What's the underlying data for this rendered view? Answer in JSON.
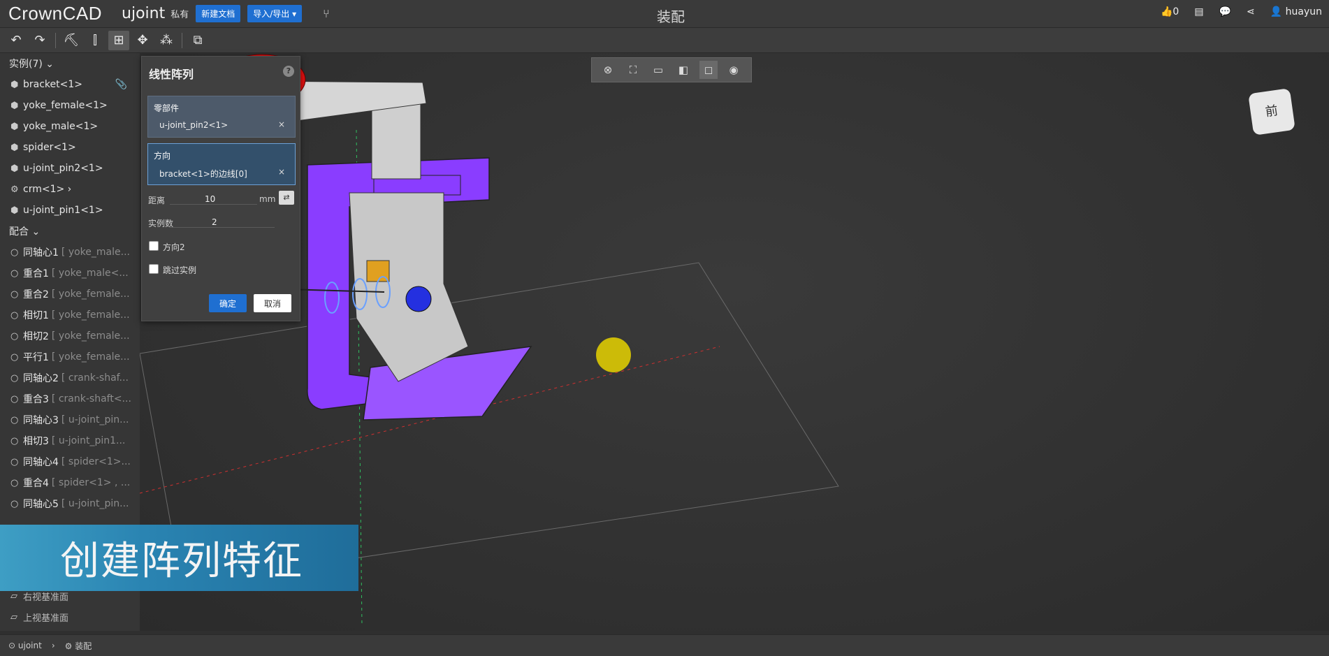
{
  "topbar": {
    "logo": "CrownCAD",
    "doc_name": "ujoint",
    "privacy": "私有",
    "new_doc": "新建文档",
    "import_export": "导入/导出 ▾",
    "title": "装配",
    "likes": "0",
    "user": "huayun"
  },
  "sidebar": {
    "instances_header": "实例(7) ⌄",
    "instances": [
      {
        "icon": "part-icon",
        "label": "bracket<1>"
      },
      {
        "icon": "part-icon",
        "label": "yoke_female<1>"
      },
      {
        "icon": "part-icon",
        "label": "yoke_male<1>"
      },
      {
        "icon": "part-icon",
        "label": "spider<1>"
      },
      {
        "icon": "part-icon",
        "label": "u-joint_pin2<1>"
      },
      {
        "icon": "assembly-icon",
        "label": "crm<1> ›"
      },
      {
        "icon": "part-icon",
        "label": "u-joint_pin1<1>"
      }
    ],
    "mates_header": "配合 ⌄",
    "mates": [
      {
        "label": "同轴心1",
        "extra": "[ yoke_male..."
      },
      {
        "label": "重合1",
        "extra": "[ yoke_male<..."
      },
      {
        "label": "重合2",
        "extra": "[ yoke_female..."
      },
      {
        "label": "相切1",
        "extra": "[ yoke_female..."
      },
      {
        "label": "相切2",
        "extra": "[ yoke_female..."
      },
      {
        "label": "平行1",
        "extra": "[ yoke_female..."
      },
      {
        "label": "同轴心2",
        "extra": "[ crank-shaf..."
      },
      {
        "label": "重合3",
        "extra": "[ crank-shaft<..."
      },
      {
        "label": "同轴心3",
        "extra": "[ u-joint_pin..."
      },
      {
        "label": "相切3",
        "extra": "[ u-joint_pin1..."
      },
      {
        "label": "同轴心4",
        "extra": "[ spider<1>..."
      },
      {
        "label": "重合4",
        "extra": "[ spider<1> , ..."
      },
      {
        "label": "同轴心5",
        "extra": "[ u-joint_pin..."
      }
    ],
    "planes": [
      {
        "label": "右视基准面"
      },
      {
        "label": "上视基准面"
      }
    ]
  },
  "panel": {
    "title": "线性阵列",
    "component_label": "零部件",
    "component_value": "u-joint_pin2<1>",
    "direction_label": "方向",
    "direction_value": "bracket<1>的边线[0]",
    "distance_label": "距离",
    "distance_value": "10",
    "distance_unit": "mm",
    "count_label": "实例数",
    "count_value": "2",
    "dir2_label": "方向2",
    "skip_label": "跳过实例",
    "ok": "确定",
    "cancel": "取消"
  },
  "caption": "创建阵列特征",
  "statusbar": {
    "doc": "ujoint",
    "separator": "›",
    "assembly": "装配"
  },
  "colors": {
    "accent": "#1f6fd1",
    "purple_part": "#8a3dff",
    "caption_bg": "#2a84b2"
  }
}
